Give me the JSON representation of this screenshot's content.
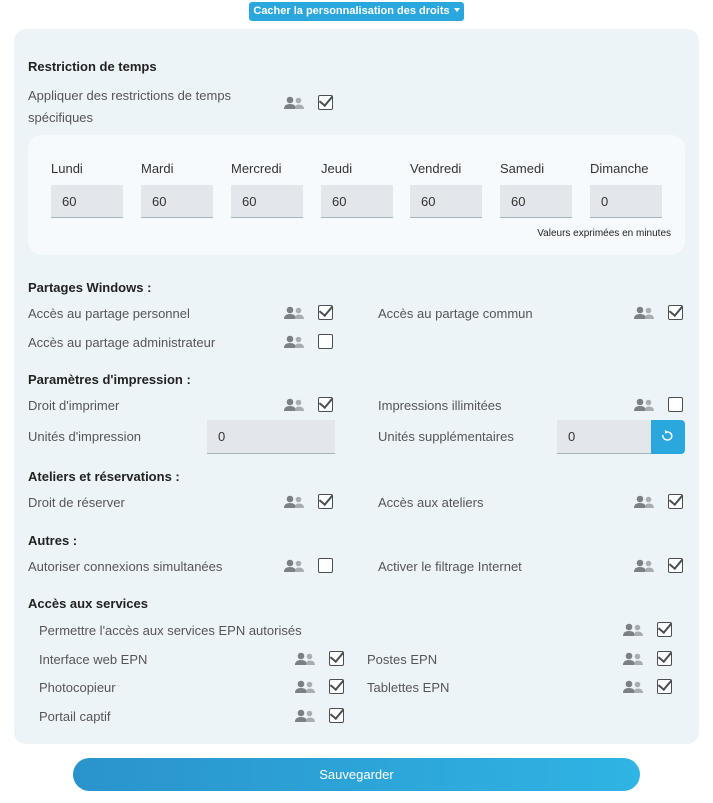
{
  "toggle": {
    "label": "Cacher la personnalisation des droits"
  },
  "time": {
    "title": "Restriction de temps",
    "apply_label_line1": "Appliquer des restrictions de temps",
    "apply_label_line2": "spécifiques",
    "apply_checked": true,
    "days": [
      {
        "name": "Lundi",
        "value": "60"
      },
      {
        "name": "Mardi",
        "value": "60"
      },
      {
        "name": "Mercredi",
        "value": "60"
      },
      {
        "name": "Jeudi",
        "value": "60"
      },
      {
        "name": "Vendredi",
        "value": "60"
      },
      {
        "name": "Samedi",
        "value": "60"
      },
      {
        "name": "Dimanche",
        "value": "0"
      }
    ],
    "note": "Valeurs exprimées en minutes"
  },
  "shares": {
    "title": "Partages Windows :",
    "personal": {
      "label": "Accès au partage personnel",
      "checked": true
    },
    "common": {
      "label": "Accès au partage commun",
      "checked": true
    },
    "admin": {
      "label": "Accès au partage administrateur",
      "checked": false
    }
  },
  "printing": {
    "title": "Paramètres d'impression :",
    "right": {
      "label": "Droit d'imprimer",
      "checked": true
    },
    "unlimited": {
      "label": "Impressions illimitées",
      "checked": false
    },
    "units": {
      "label": "Unités d'impression",
      "value": "0"
    },
    "extra": {
      "label": "Unités supplémentaires",
      "value": "0"
    }
  },
  "workshops": {
    "title": "Ateliers et réservations :",
    "reserve": {
      "label": "Droit de réserver",
      "checked": true
    },
    "access": {
      "label": "Accès aux ateliers",
      "checked": true
    }
  },
  "others": {
    "title": "Autres :",
    "simultaneous": {
      "label": "Autoriser connexions simultanées",
      "checked": false
    },
    "filtering": {
      "label": "Activer le filtrage Internet",
      "checked": true
    }
  },
  "services": {
    "title": "Accès aux services",
    "allow": {
      "label": "Permettre l'accès aux services EPN autorisés",
      "checked": true
    },
    "web": {
      "label": "Interface web EPN",
      "checked": true
    },
    "posts": {
      "label": "Postes EPN",
      "checked": true
    },
    "copier": {
      "label": "Photocopieur",
      "checked": true
    },
    "tablets": {
      "label": "Tablettes EPN",
      "checked": true
    },
    "portal": {
      "label": "Portail captif",
      "checked": true
    }
  },
  "save": {
    "label": "Sauvegarder"
  },
  "icons": {
    "users": "users-icon",
    "refresh": "refresh-icon"
  }
}
